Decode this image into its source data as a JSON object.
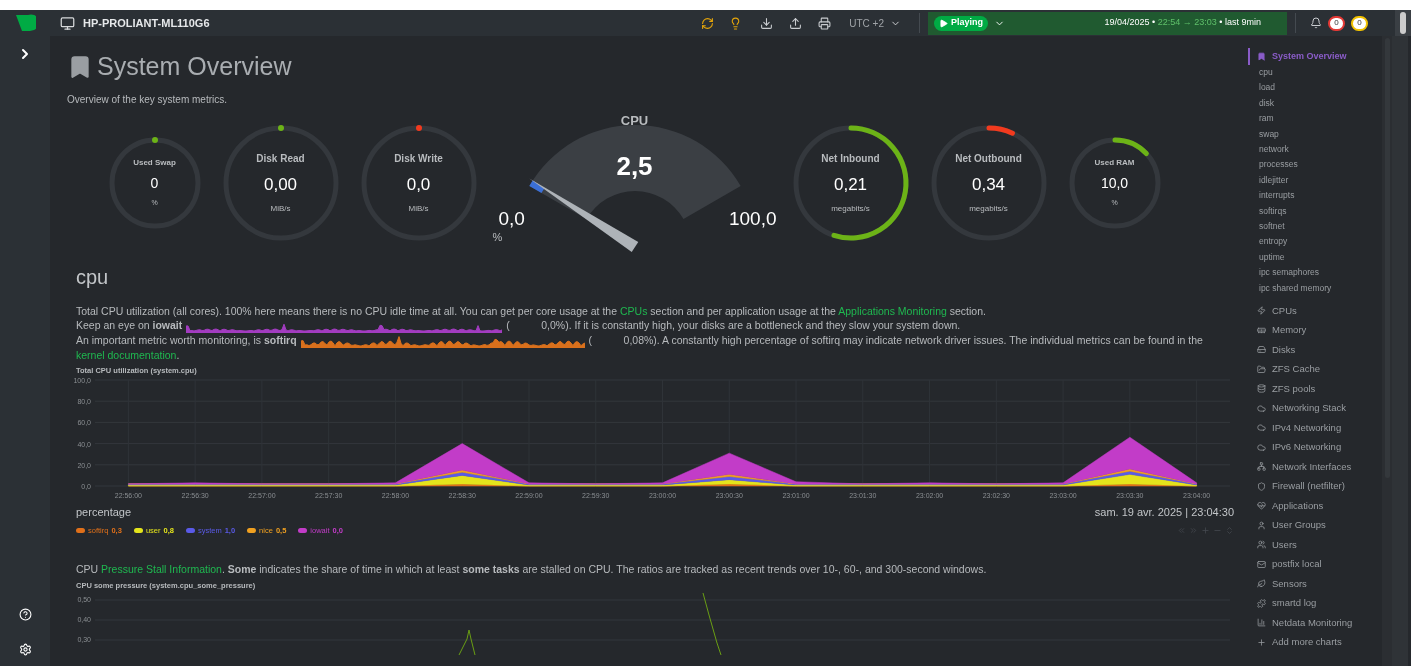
{
  "top_bar": {
    "host_name": "HP-PROLIANT-ML110G6",
    "timezone": "UTC +2",
    "playback": {
      "label": "Playing",
      "on": true
    },
    "time_range": {
      "date": "19/04/2025 •",
      "from": "22:54",
      "arrow": "→",
      "to": "23:03",
      "duration": "• last 9min"
    },
    "badges": [
      {
        "text": "0",
        "color": "#e53935"
      },
      {
        "text": "0",
        "color": "#f2c200"
      }
    ]
  },
  "overview": {
    "title": "System Overview",
    "subtitle": "Overview of the key system metrics."
  },
  "gauges": [
    {
      "kind": "mini",
      "label": "Used Swap",
      "value": "0",
      "unit": "%",
      "color": "#6cb317"
    },
    {
      "kind": "ring",
      "label": "Disk Read",
      "value": "0,00",
      "unit": "MiB/s",
      "color": "#6cb317"
    },
    {
      "kind": "ring",
      "label": "Disk Write",
      "value": "0,0",
      "unit": "MiB/s",
      "color": "#f23a1e"
    },
    {
      "kind": "dial",
      "label": "CPU",
      "value": "2,5",
      "min": "0,0",
      "max": "100,0",
      "unit": "%"
    },
    {
      "kind": "ring",
      "label": "Net Inbound",
      "value": "0,21",
      "unit": "megabits/s",
      "color": "#6cb317"
    },
    {
      "kind": "ring",
      "label": "Net Outbound",
      "value": "0,34",
      "unit": "megabits/s",
      "color": "#f23a1e"
    },
    {
      "kind": "mini",
      "label": "Used RAM",
      "value": "10,0",
      "unit": "%",
      "color": "#6cb317"
    }
  ],
  "cpu_section": {
    "heading": "cpu",
    "intro": [
      [
        {
          "kind": "text",
          "text": "Total CPU utilization (all cores). 100% here means there is no CPU idle time at all. You can get per core usage at the "
        },
        {
          "kind": "link",
          "text": "CPUs"
        },
        {
          "kind": "text",
          "text": " section and per application usage at the "
        },
        {
          "kind": "link",
          "text": "Applications Monitoring"
        },
        {
          "kind": "text",
          "text": " section."
        }
      ],
      [
        {
          "kind": "text",
          "text": "Keep an eye on **iowait**"
        },
        {
          "kind": "sparkline",
          "color": "#a23cc0"
        },
        {
          "kind": "text",
          "text": "(   0,0%). If it is constantly high, your disks are a bottleneck and they slow your system down."
        }
      ],
      [
        {
          "kind": "text",
          "text": "An important metric worth monitoring, is **softirq**"
        },
        {
          "kind": "sparkline",
          "color": "#d9701c"
        },
        {
          "kind": "text",
          "text": "(   0,08%). A constantly high percentage of softirq may indicate network driver issues. The individual metrics can be found in the "
        },
        {
          "kind": "link",
          "text": "kernel documentation"
        },
        {
          "kind": "text",
          "text": "."
        }
      ]
    ],
    "utilization_chart": {
      "timestamp": "sam. 19 avr. 2025 | 23:04:30",
      "legend_values": [
        "0,3",
        "0,8",
        "1,0",
        "0,5",
        "0,0"
      ],
      "chart_data": {
        "type": "area",
        "stacked": true,
        "grid": true,
        "title": "Total CPU utilization (system.cpu)",
        "ylabel": "percentage",
        "categories": [
          "22:56:00",
          "22:56:30",
          "22:57:00",
          "22:57:30",
          "22:58:00",
          "22:58:30",
          "22:59:00",
          "22:59:30",
          "23:00:00",
          "23:00:30",
          "23:01:00",
          "23:01:30",
          "23:02:00",
          "23:02:30",
          "23:03:00",
          "23:03:30",
          "23:04:00"
        ],
        "ylim": [
          0,
          100
        ],
        "yticks": [
          {
            "value": 0,
            "label": "0,0"
          },
          {
            "value": 20,
            "label": "20,0"
          },
          {
            "value": 40,
            "label": "40,0"
          },
          {
            "value": 60,
            "label": "60,0"
          },
          {
            "value": 80,
            "label": "80,0"
          },
          {
            "value": 100,
            "label": "100,0"
          }
        ],
        "series": [
          {
            "name": "softirq",
            "color": "#e0701a",
            "values": [
              0,
              0,
              0,
              0,
              0,
              2,
              0,
              0,
              0,
              2,
              0,
              0,
              0,
              0,
              0,
              2,
              0
            ]
          },
          {
            "name": "user",
            "color": "#e4e41c",
            "values": [
              1,
              1,
              1,
              1,
              1,
              8,
              1,
              1,
              1,
              4,
              1,
              1,
              1,
              1,
              1,
              9,
              1
            ]
          },
          {
            "name": "system",
            "color": "#5a5ae8",
            "values": [
              1,
              1,
              1,
              1,
              1,
              3,
              1,
              1,
              1,
              3,
              1,
              1,
              1,
              1,
              1,
              3,
              1
            ]
          },
          {
            "name": "nice",
            "color": "#f0a020",
            "values": [
              0,
              0,
              0,
              0,
              0,
              2,
              0,
              0,
              0,
              2,
              0,
              0,
              0,
              0,
              0,
              2,
              0
            ]
          },
          {
            "name": "iowait",
            "color": "#c23cc8",
            "values": [
              0,
              1,
              0,
              0,
              1,
              25,
              1,
              0,
              1,
              20,
              2,
              0,
              1,
              0,
              1,
              30,
              1
            ]
          }
        ]
      }
    },
    "pressure_note": [
      {
        "kind": "text",
        "text": "CPU "
      },
      {
        "kind": "link",
        "text": "Pressure Stall Information"
      },
      {
        "kind": "text",
        "text": ". **Some** indicates the share of time in which at least **some tasks** are stalled on CPU. The ratios are tracked as recent trends over 10-, 60-, and 300-second windows."
      }
    ],
    "pressure_chart": {
      "title": "CPU some pressure (system.cpu_some_pressure)",
      "y_labels": [
        "0,50",
        "0,40",
        "0,30"
      ]
    }
  },
  "nav": {
    "items": [
      {
        "label": "System Overview",
        "selected": true,
        "children": [
          {
            "label": "cpu"
          },
          {
            "label": "load"
          },
          {
            "label": "disk"
          },
          {
            "label": "ram"
          },
          {
            "label": "swap"
          },
          {
            "label": "network"
          },
          {
            "label": "processes"
          },
          {
            "label": "idlejitter"
          },
          {
            "label": "interrupts"
          },
          {
            "label": "softirqs"
          },
          {
            "label": "softnet"
          },
          {
            "label": "entropy"
          },
          {
            "label": "uptime"
          },
          {
            "label": "ipc semaphores"
          },
          {
            "label": "ipc shared memory"
          }
        ]
      },
      {
        "label": "CPUs",
        "selected": false
      },
      {
        "label": "Memory",
        "selected": false
      },
      {
        "label": "Disks",
        "selected": false
      },
      {
        "label": "ZFS Cache",
        "selected": false
      },
      {
        "label": "ZFS pools",
        "selected": false
      },
      {
        "label": "Networking Stack",
        "selected": false
      },
      {
        "label": "IPv4 Networking",
        "selected": false
      },
      {
        "label": "IPv6 Networking",
        "selected": false
      },
      {
        "label": "Network Interfaces",
        "selected": false
      },
      {
        "label": "Firewall (netfilter)",
        "selected": false
      },
      {
        "label": "Applications",
        "selected": false
      },
      {
        "label": "User Groups",
        "selected": false
      },
      {
        "label": "Users",
        "selected": false
      },
      {
        "label": "postfix local",
        "selected": false
      },
      {
        "label": "Sensors",
        "selected": false
      },
      {
        "label": "smartd log",
        "selected": false
      },
      {
        "label": "Netdata Monitoring",
        "selected": false
      },
      {
        "label": "Add more charts",
        "selected": false
      }
    ]
  }
}
